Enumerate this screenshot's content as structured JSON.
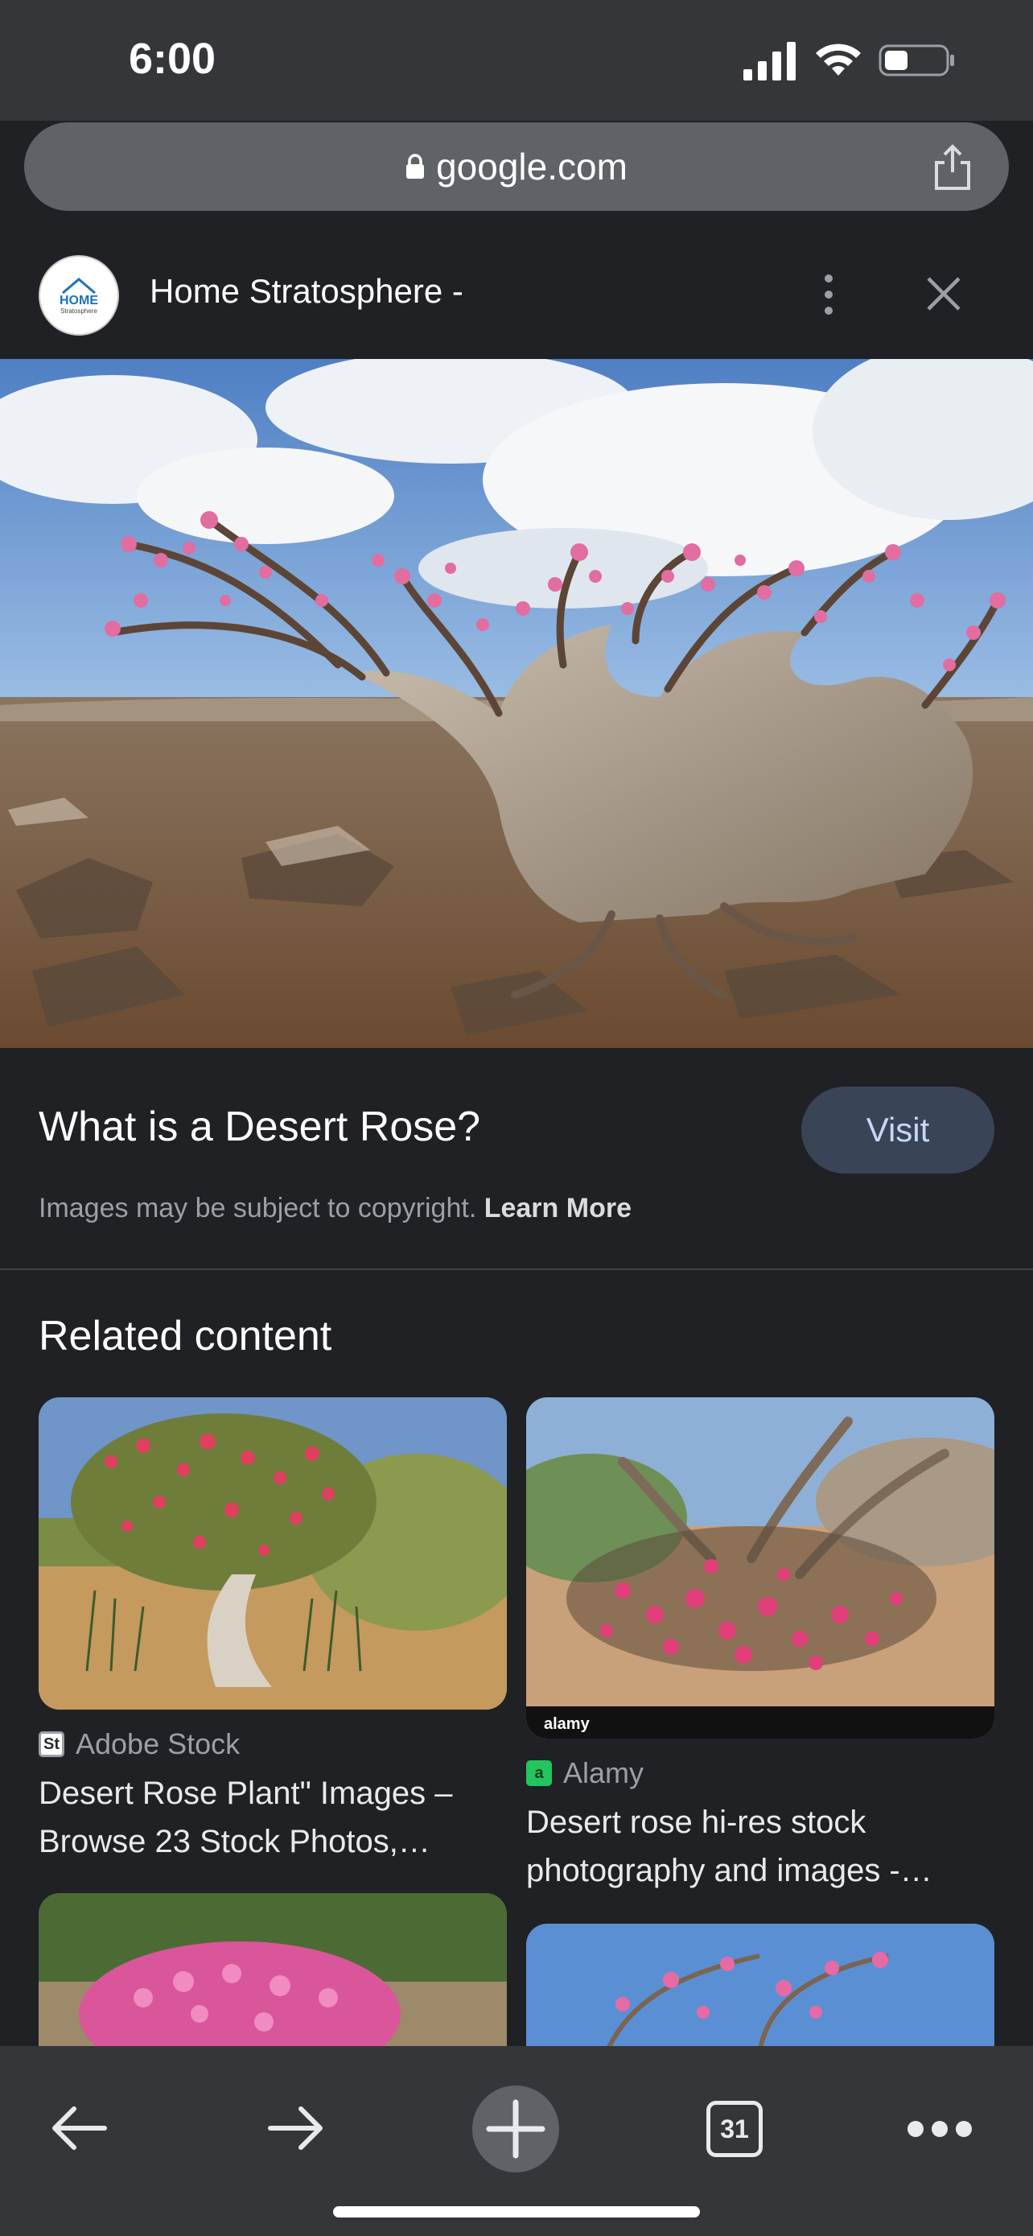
{
  "status_bar": {
    "time": "6:00"
  },
  "browser": {
    "url": "google.com"
  },
  "source_bar": {
    "site_title": "Home Stratosphere -",
    "logo_text": "HOME",
    "logo_sub": "Stratosphere"
  },
  "image_info": {
    "title": "What is a Desert Rose?",
    "visit_label": "Visit",
    "copyright_text": "Images may be subject to copyright.",
    "learn_more_label": "Learn More"
  },
  "related": {
    "heading": "Related content",
    "items": [
      {
        "source": "Adobe Stock",
        "favicon": "St",
        "favicon_color": "#2b2b2b",
        "title": "Desert Rose Plant\" Images – Browse 23 Stock Photos,…"
      },
      {
        "source": "Alamy",
        "favicon": "a",
        "favicon_color": "#22c55e",
        "title": "Desert rose hi-res stock photography and images -…"
      }
    ]
  },
  "bottom_toolbar": {
    "tab_count": "31",
    "icons": [
      "back-arrow-icon",
      "forward-arrow-icon",
      "new-tab-plus-icon",
      "tab-switcher-icon",
      "more-dots-icon"
    ]
  }
}
